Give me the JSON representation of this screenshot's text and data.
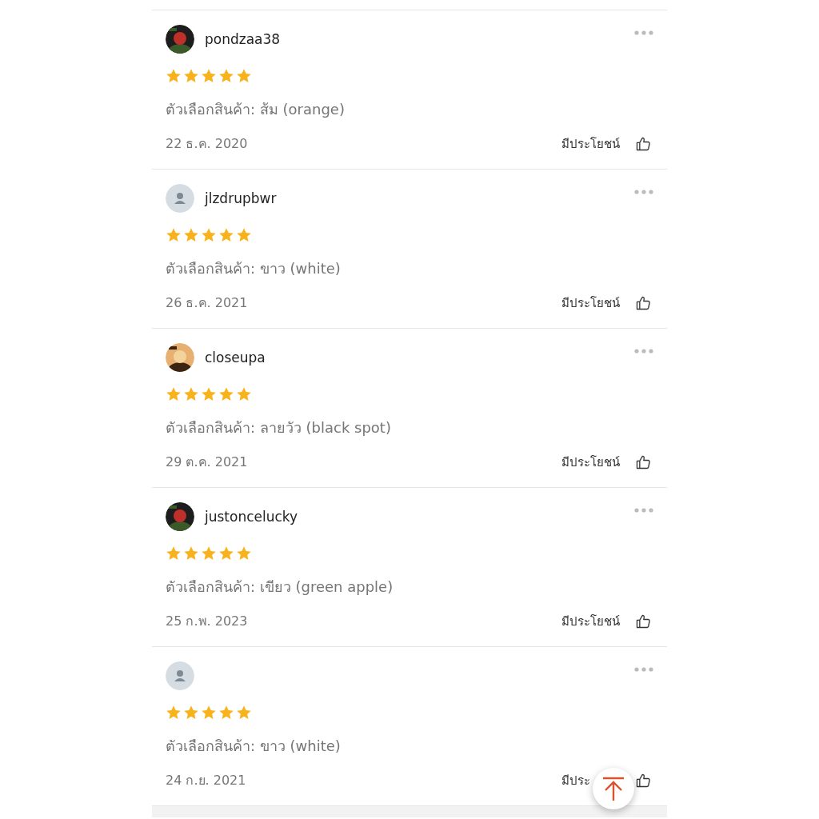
{
  "reviews": [
    {
      "username": "pondzaa38",
      "stars": 5,
      "variant": "ตัวเลือกสินค้า: ส้ม (orange)",
      "date": "22 ธ.ค. 2020",
      "helpful": "มีประโยชน์"
    },
    {
      "avatar": {
        "kind": "default"
      },
      "username": "jlzdrupbwr",
      "stars": 5,
      "variant": "ตัวเลือกสินค้า: ขาว (white)",
      "date": "26 ธ.ค. 2021",
      "helpful": "มีประโยชน์"
    },
    {
      "username": "closeupa",
      "stars": 5,
      "variant": "ตัวเลือกสินค้า: ลายวัว (black spot)",
      "date": "29 ต.ค. 2021",
      "helpful": "มีประโยชน์"
    },
    {
      "username": "justoncelucky",
      "stars": 5,
      "variant": "ตัวเลือกสินค้า: เขียว (green apple)",
      "date": "25 ก.พ. 2023",
      "helpful": "มีประโยชน์"
    },
    {
      "avatar": {
        "kind": "default"
      },
      "stars": 5,
      "variant": "ตัวเลือกสินค้า: ขาว (white)",
      "date": "24 ก.ย. 2021",
      "helpful": "มีประ"
    }
  ]
}
